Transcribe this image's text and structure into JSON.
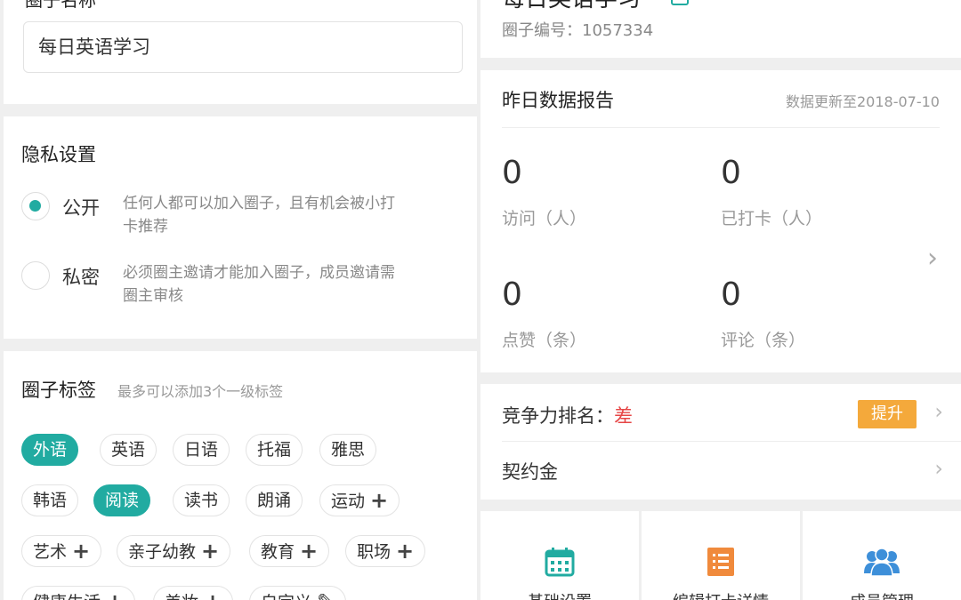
{
  "left": {
    "name_section": {
      "label": "圈子名称",
      "value": "每日英语学习"
    },
    "privacy": {
      "title": "隐私设置",
      "options": [
        {
          "label": "公开",
          "desc_line1": "任何人都可以加入圈子，且有机会被小打",
          "desc_line2": "卡推荐",
          "selected": true
        },
        {
          "label": "私密",
          "desc_line1": "必须圈主邀请才能加入圈子，成员邀请需",
          "desc_line2": "圈主审核",
          "selected": false
        }
      ]
    },
    "tags": {
      "title": "圈子标签",
      "hint": "最多可以添加3个一级标签",
      "items": [
        {
          "label": "外语",
          "selected": true
        },
        {
          "label": "英语",
          "selected": false
        },
        {
          "label": "日语",
          "selected": false
        },
        {
          "label": "托福",
          "selected": false
        },
        {
          "label": "雅思",
          "selected": false
        },
        {
          "label": "韩语",
          "selected": false
        },
        {
          "label": "阅读",
          "selected": true
        },
        {
          "label": "读书",
          "selected": false
        },
        {
          "label": "朗诵",
          "selected": false
        },
        {
          "label": "运动",
          "selected": false,
          "expand": true
        },
        {
          "label": "艺术",
          "selected": false,
          "expand": true
        },
        {
          "label": "亲子幼教",
          "selected": false,
          "expand": true
        },
        {
          "label": "教育",
          "selected": false,
          "expand": true
        },
        {
          "label": "职场",
          "selected": false,
          "expand": true
        },
        {
          "label": "健康生活",
          "selected": false,
          "expand": true
        },
        {
          "label": "美妆",
          "selected": false,
          "expand": true
        },
        {
          "label": "自定义",
          "selected": false
        }
      ]
    }
  },
  "right": {
    "header": {
      "title": "每日英语学习",
      "id_text": "圈子编号：1057334"
    },
    "report": {
      "title": "昨日数据报告",
      "updated": "数据更新至2018-07-10",
      "stats": [
        {
          "value": "0",
          "label": "访问（人）"
        },
        {
          "value": "0",
          "label": "已打卡（人）"
        },
        {
          "value": "0",
          "label": "点赞（条）"
        },
        {
          "value": "0",
          "label": "评论（条）"
        }
      ]
    },
    "ranking": {
      "label": "竞争力排名：",
      "value": "差",
      "button": "提升"
    },
    "deposit": {
      "label": "契约金"
    },
    "grid": [
      {
        "label": "基础设置",
        "icon": "calendar-icon"
      },
      {
        "label": "编辑打卡详情",
        "icon": "list-icon"
      },
      {
        "label": "成员管理",
        "icon": "members-icon"
      }
    ]
  },
  "colors": {
    "accent": "#21aba1",
    "warn": "#e64646",
    "boost": "#f4a93b",
    "grid_orange": "#f08a3c",
    "grid_blue": "#3d8fd9"
  }
}
